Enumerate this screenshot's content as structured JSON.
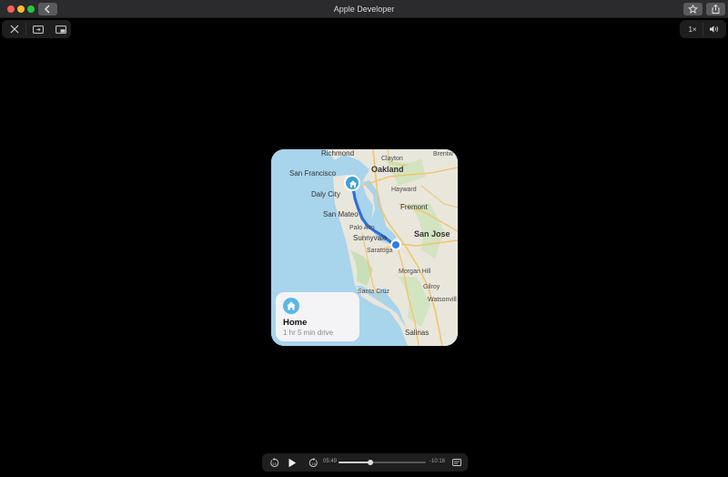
{
  "window": {
    "title": "Apple Developer"
  },
  "player": {
    "speed_label": "1×",
    "elapsed": "05:49",
    "remaining": "-10:16",
    "progress": 0.36
  },
  "map": {
    "cities": {
      "richmond": "Richmond",
      "brentwood": "Brentw",
      "clayton": "Clayton",
      "oakland": "Oakland",
      "san_francisco": "San Francisco",
      "daly_city": "Daly City",
      "hayward": "Hayward",
      "fremont": "Fremont",
      "san_mateo": "San Mateo",
      "palo_alto": "Palo Alto",
      "sunnyvale": "Sunnyvale",
      "san_jose": "San Jose",
      "saratoga": "Saratoga",
      "morgan_hill": "Morgan Hill",
      "santa_cruz": "Santa Cruz",
      "gilroy": "Gilroy",
      "watsonville": "Watsonvill",
      "salinas": "Salinas"
    },
    "home_card": {
      "title": "Home",
      "subtitle": "1 hr 5 min drive"
    }
  },
  "colors": {
    "water": "#a8d4ec",
    "land": "#e9e6dc",
    "route": "#2f6fd6",
    "pin": "#3d9fd8"
  }
}
